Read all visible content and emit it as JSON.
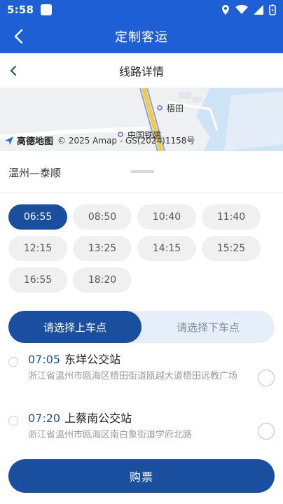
{
  "status": {
    "time": "5:58"
  },
  "appbar": {
    "title": "定制客运"
  },
  "subbar": {
    "title": "线路详情"
  },
  "map": {
    "brand": "高德地图",
    "copyright": "© 2025 Amap - GS(2024)1158号",
    "poi_1": "梧田",
    "poi_2": "中国铁建"
  },
  "route": {
    "name": "温州—泰顺"
  },
  "times": [
    "06:55",
    "08:50",
    "10:40",
    "11:40",
    "12:15",
    "13:25",
    "14:15",
    "15:25",
    "16:55",
    "18:20"
  ],
  "selected_time": "06:55",
  "segment": {
    "board": "请选择上车点",
    "alight": "请选择下车点"
  },
  "stops": [
    {
      "time": "07:05",
      "name": "东垟公交站",
      "address": "浙江省温州市瓯海区梧田街道瓯越大道梧田远教广场"
    },
    {
      "time": "07:20",
      "name": "上蔡南公交站",
      "address": "浙江省温州市瓯海区南白象街道学府北路"
    }
  ],
  "buy_label": "购票",
  "colors": {
    "primary": "#1f5fd6",
    "accent": "#1a4fa0"
  }
}
